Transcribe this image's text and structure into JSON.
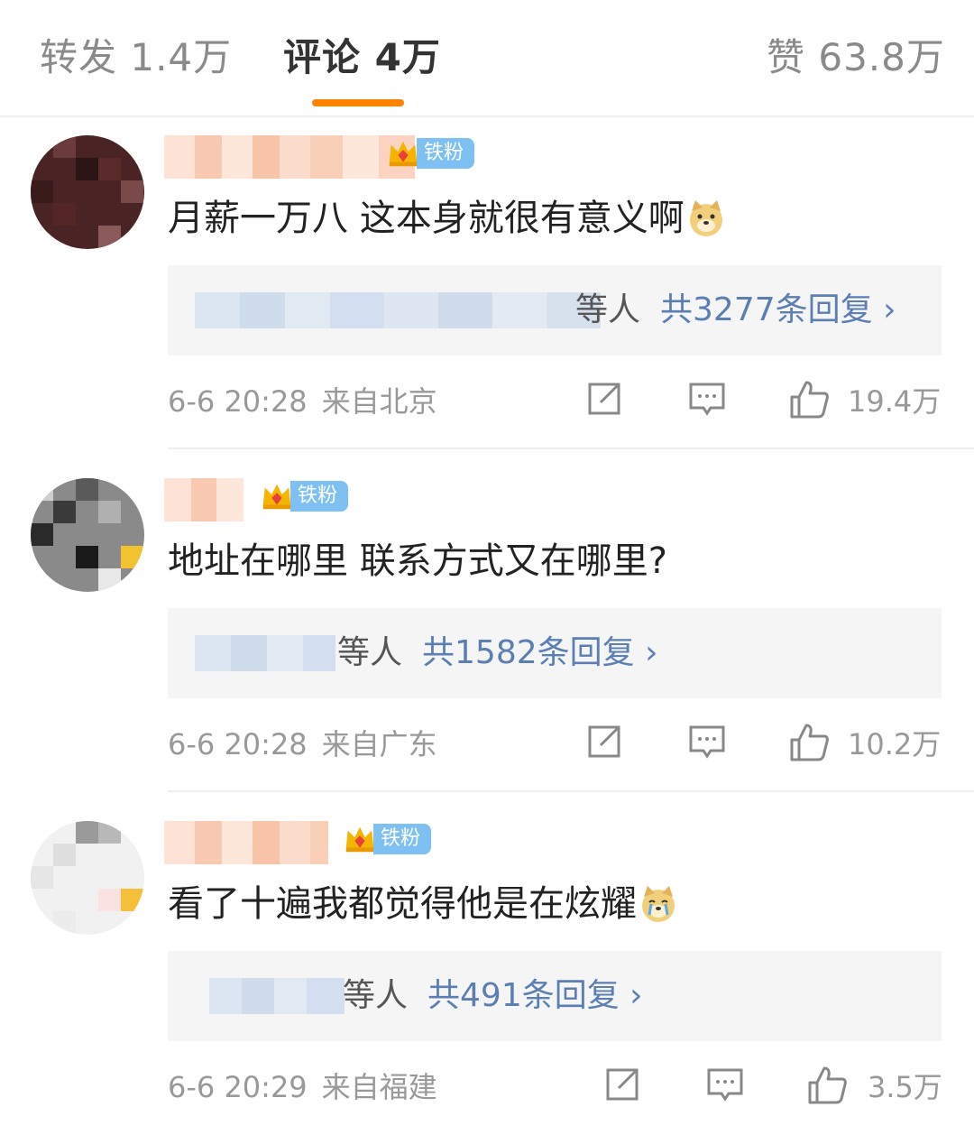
{
  "tabs": {
    "repost": "转发 1.4万",
    "comments": "评论 4万",
    "likes": "赞 63.8万"
  },
  "colors": {
    "accent": "#ff8200",
    "link": "#5b7fb5",
    "fan_badge": "#7fc0f2"
  },
  "badge_label": "铁粉",
  "comments": [
    {
      "text": "月薪一万八 这本身就很有意义啊",
      "emoji": "doge-emoji",
      "badge_level": "2",
      "reply_suffix": "等人",
      "reply_link": "共3277条回复 ›",
      "time": "6-6 20:28",
      "location": "来自北京",
      "likes": "19.4万"
    },
    {
      "text": "地址在哪里 联系方式又在哪里?",
      "emoji": "",
      "badge_level": "6",
      "reply_suffix": "等人",
      "reply_link": "共1582条回复 ›",
      "time": "6-6 20:28",
      "location": "来自广东",
      "likes": "10.2万"
    },
    {
      "text": "看了十遍我都觉得他是在炫耀",
      "emoji": "crying-doge-emoji",
      "badge_level": "1",
      "reply_suffix": "等人",
      "reply_link": "共491条回复 ›",
      "time": "6-6 20:29",
      "location": "来自福建",
      "likes": "3.5万"
    }
  ]
}
